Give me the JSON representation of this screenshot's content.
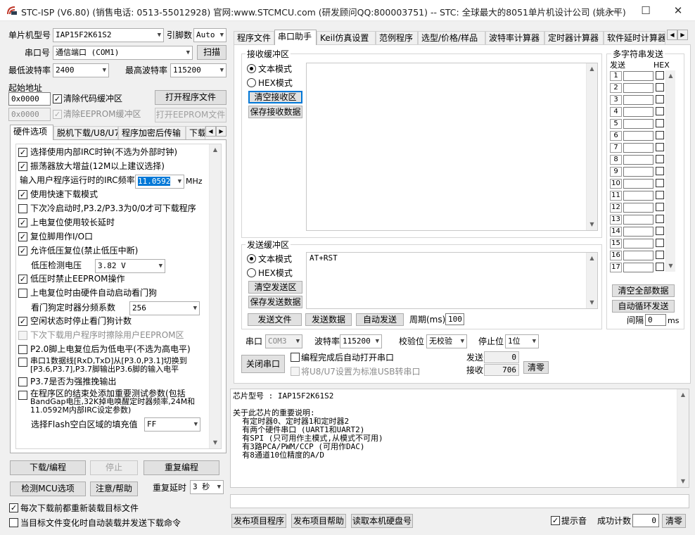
{
  "window": {
    "title": "STC-ISP (V6.80) (销售电话: 0513-55012928) 官网:www.STCMCU.com  (研发顾问QQ:800003751)  -- STC: 全球最大的8051单片机设计公司 (姚永平)",
    "minimize": "—",
    "maximize": "☐",
    "close": "✕"
  },
  "left": {
    "mcu_label": "单片机型号",
    "mcu_value": "IAP15F2K61S2",
    "pins_label": "引脚数",
    "pins_value": "Auto",
    "port_label": "串口号",
    "port_value": "通信端口 (COM1)",
    "scan_button": "扫描",
    "min_baud_label": "最低波特率",
    "min_baud_value": "2400",
    "max_baud_label": "最高波特率",
    "max_baud_value": "115200",
    "start_addr_label": "起始地址",
    "addr1_value": "0x0000",
    "clear_code_label": "清除代码缓冲区",
    "clear_code_checked": "✓",
    "open_prog_button": "打开程序文件",
    "addr2_value": "0x0000",
    "clear_eeprom_label": "清除EEPROM缓冲区",
    "clear_eeprom_checked": "✓",
    "open_eeprom_button": "打开EEPROM文件",
    "tabs": [
      "硬件选项",
      "脱机下载/U8/U7",
      "程序加密后传输",
      "下载"
    ],
    "options": [
      {
        "label": "选择使用内部IRC时钟(不选为外部时钟)",
        "mark": "✓"
      },
      {
        "label": "振荡器放大增益(12M以上建议选择)",
        "mark": "✓"
      },
      {
        "label": "使用快速下载模式",
        "mark": "✓"
      },
      {
        "label": "下次冷启动时,P3.2/P3.3为0/0才可下载程序",
        "mark": ""
      },
      {
        "label": "上电复位使用较长延时",
        "mark": "✓"
      },
      {
        "label": "复位脚用作I/O口",
        "mark": "✓"
      },
      {
        "label": "允许低压复位(禁止低压中断)",
        "mark": "✓"
      },
      {
        "label": "低压时禁止EEPROM操作",
        "mark": "✓"
      },
      {
        "label": "上电复位时由硬件自动启动看门狗",
        "mark": ""
      },
      {
        "label": "空闲状态时停止看门狗计数",
        "mark": "✓"
      },
      {
        "label": "下次下载用户程序时擦除用户EEPROM区",
        "mark": ""
      },
      {
        "label": "P2.0脚上电复位后为低电平(不选为高电平)",
        "mark": ""
      },
      {
        "label": "P3.7是否为强推挽输出",
        "mark": ""
      }
    ],
    "irc_label": "输入用户程序运行时的IRC频率",
    "irc_value": "11.0592",
    "irc_unit": "MHz",
    "lvd_label": "低压检测电压",
    "lvd_value": "3.82 V",
    "wdt_label": "看门狗定时器分频系数",
    "wdt_value": "256",
    "uart1_line1": "串口1数据线[RxD,TxD]从[P3.0,P3.1]切换到",
    "uart1_line2": "[P3.6,P3.7],P3.7脚输出P3.6脚的输入电平",
    "uart1_mark": "",
    "test_line1": "在程序区的结束处添加重要测试参数(包括",
    "test_line2": "BandGap电压,32K掉电唤醒定时器频率,24M和",
    "test_line3": "11.0592M内部IRC设定参数)",
    "test_mark": "",
    "flash_fill_label": "选择Flash空白区域的填充值",
    "flash_fill_value": "FF",
    "download_button": "下载/编程",
    "stop_button": "停止",
    "reprogram_button": "重复编程",
    "detect_button": "检测MCU选项",
    "help_button": "注意/帮助",
    "repeat_delay_label": "重复延时",
    "repeat_delay_value": "3 秒",
    "reload_label": "每次下载前都重新装载目标文件",
    "reload_mark": "✓",
    "auto_load_label": "当目标文件变化时自动装载并发送下载命令",
    "auto_load_mark": ""
  },
  "right": {
    "tabs": [
      "程序文件",
      "串口助手",
      "Keil仿真设置",
      "范例程序",
      "选型/价格/样品",
      "波特率计算器",
      "定时器计算器",
      "软件延时计算器"
    ],
    "recv_title": "接收缓冲区",
    "recv_text_mode": "文本模式",
    "recv_hex_mode": "HEX模式",
    "clear_recv_button": "清空接收区",
    "save_recv_button": "保存接收数据",
    "send_title": "发送缓冲区",
    "send_text_mode": "文本模式",
    "send_hex_mode": "HEX模式",
    "clear_send_button": "清空发送区",
    "save_send_button": "保存发送数据",
    "send_content": "AT+RST",
    "send_file_button": "发送文件",
    "send_data_button": "发送数据",
    "auto_send_button": "自动发送",
    "period_label": "周期(ms)",
    "period_value": "100",
    "multi_title": "多字符串发送",
    "multi_send_col": "发送",
    "multi_hex_col": "HEX",
    "multi_rows": [
      "1",
      "2",
      "3",
      "4",
      "5",
      "6",
      "7",
      "8",
      "9",
      "10",
      "11",
      "12",
      "13",
      "14",
      "15",
      "16",
      "17"
    ],
    "clear_all_button": "清空全部数据",
    "loop_send_button": "自动循环发送",
    "interval_label": "间隔",
    "interval_value": "0",
    "interval_unit": "ms",
    "port_label": "串口",
    "port_value": "COM3",
    "baud_label": "波特率",
    "baud_value": "115200",
    "parity_label": "校验位",
    "parity_value": "无校验",
    "stopbit_label": "停止位",
    "stopbit_value": "1位",
    "close_port_button": "关闭串口",
    "auto_open_label": "编程完成后自动打开串口",
    "auto_open_mark": "",
    "usb_label": "将U8/U7设置为标准USB转串口",
    "usb_mark": "",
    "sent_label": "发送",
    "sent_value": "0",
    "recv_label": "接收",
    "recv_value": "706",
    "clear_count_button": "清零",
    "info_text": "芯片型号 : IAP15F2K61S2\n\n关于此芯片的重要说明:\n  有定时器0、定时器1和定时器2\n  有两个硬件串口 (UART1和UART2)\n  有SPI (只可用作主模式,从模式不可用)\n  有3路PCA/PWM/CCP (可用作DAC)\n  有8通道10位精度的A/D",
    "publish_prog_button": "发布项目程序",
    "publish_help_button": "发布项目帮助",
    "read_disk_button": "读取本机硬盘号",
    "hint_label": "提示音",
    "hint_mark": "✓",
    "success_label": "成功计数",
    "success_value": "0",
    "clear_success_button": "清零"
  }
}
